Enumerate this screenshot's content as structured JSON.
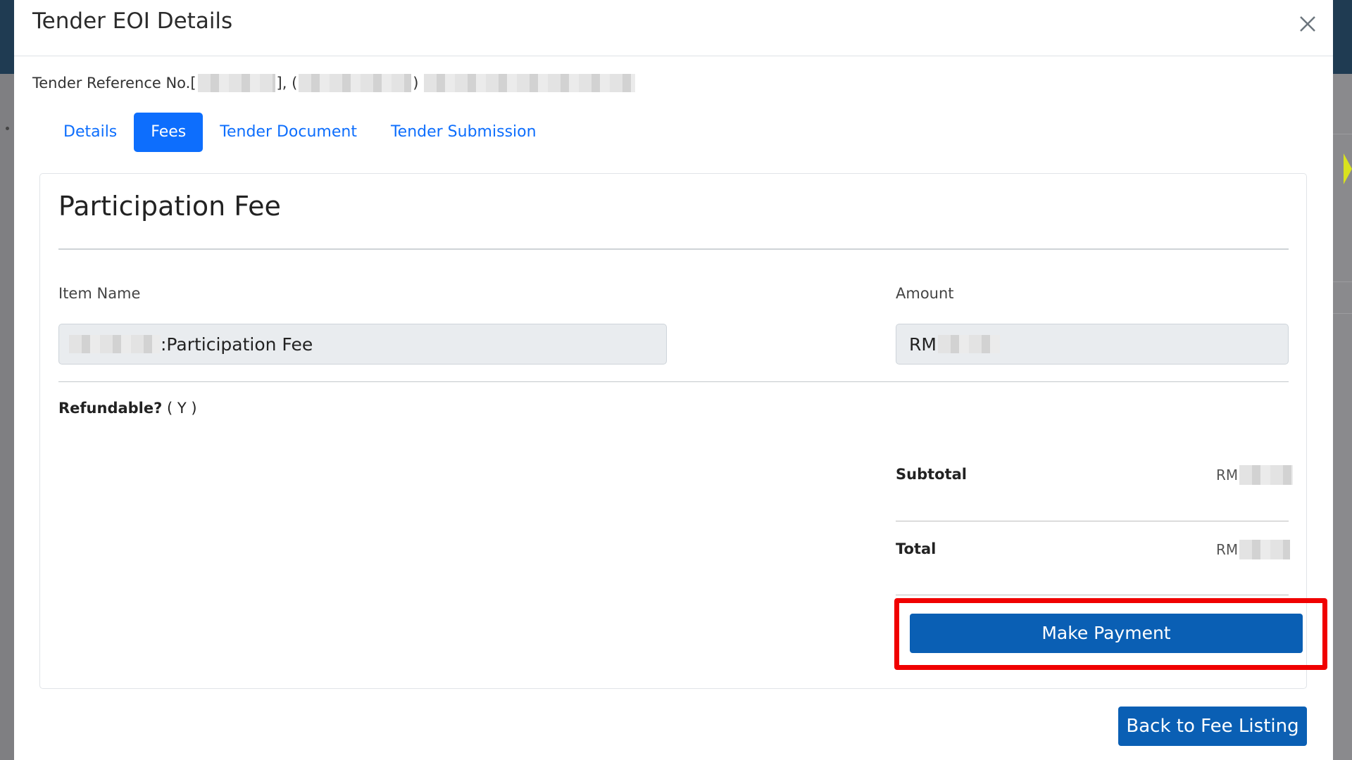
{
  "modal": {
    "title": "Tender EOI Details",
    "reference_prefix": "Tender Reference No.[",
    "reference_mid": "], (",
    "reference_suffix": ")"
  },
  "tabs": [
    {
      "label": "Details",
      "active": false
    },
    {
      "label": "Fees",
      "active": true
    },
    {
      "label": "Tender Document",
      "active": false
    },
    {
      "label": "Tender Submission",
      "active": false
    }
  ],
  "fee": {
    "section_title": "Participation Fee",
    "item_name_label": "Item Name",
    "item_name_value": ":Participation Fee",
    "amount_label": "Amount",
    "amount_currency": "RM",
    "refundable_label": "Refundable?",
    "refundable_value": "( Y )",
    "subtotal_label": "Subtotal",
    "subtotal_currency": "RM",
    "total_label": "Total",
    "total_currency": "RM"
  },
  "buttons": {
    "make_payment": "Make Payment",
    "back_to_listing": "Back to Fee Listing"
  },
  "colors": {
    "primary": "#0d6efd",
    "button_blue": "#0a5fb4",
    "highlight_red": "#f00000"
  }
}
